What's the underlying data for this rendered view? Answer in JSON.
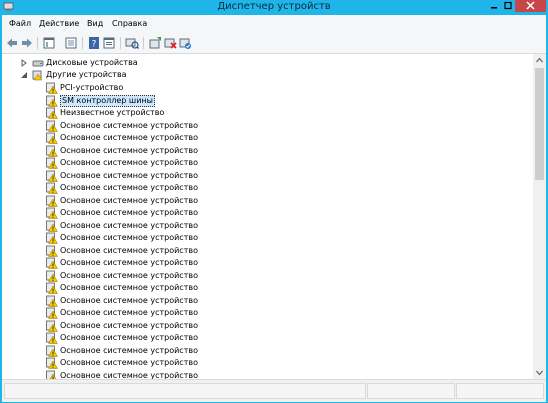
{
  "window": {
    "title": "Диспетчер устройств"
  },
  "menu": {
    "file": "Файл",
    "action": "Действие",
    "view": "Вид",
    "help": "Справка"
  },
  "toolbar": {
    "icons": [
      "back-arrow-icon",
      "forward-arrow-icon",
      "properties-panel-icon",
      "show-hidden-icon",
      "help-icon",
      "console-tree-icon",
      "scan-hardware-icon",
      "update-driver-icon",
      "uninstall-device-icon",
      "enable-device-icon"
    ]
  },
  "tree": {
    "disk_drives": "Дисковые устройства",
    "other_devices": "Другие устройства",
    "pci_device": "PCI-устройство",
    "sm_bus_controller": "SM контроллер шины",
    "unknown_device": "Неизвестное устройство",
    "base_system_device": "Основное системное устройство"
  },
  "colors": {
    "titlebar": "#1fb5e8",
    "selection": "#cce8ff",
    "close_button": "#c7464a",
    "warning_icon": "#f7c900"
  }
}
